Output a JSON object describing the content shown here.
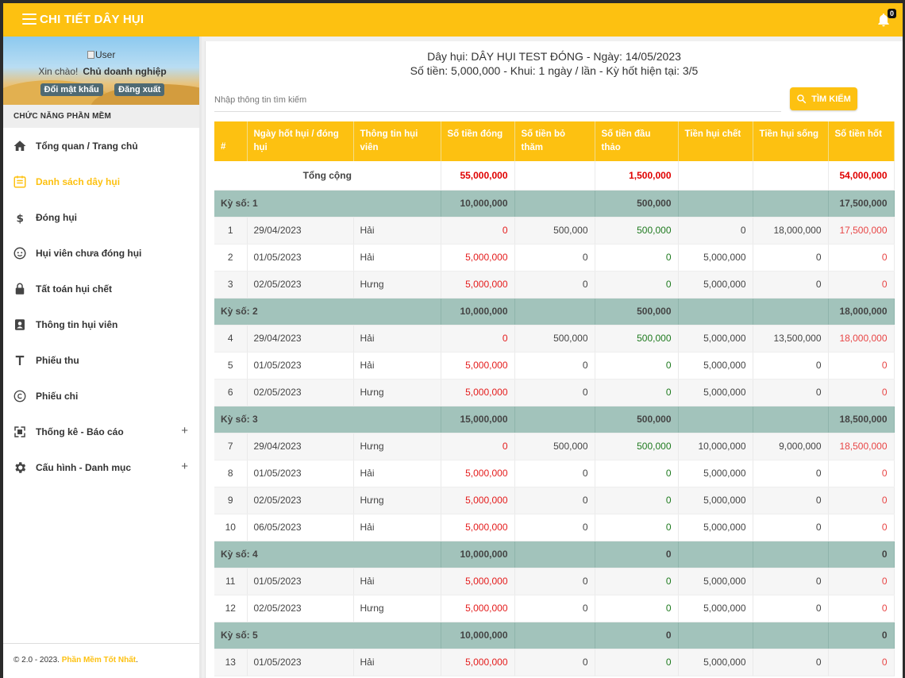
{
  "topbar": {
    "title": "CHI TIẾT DÂY HỤI",
    "badge": "0"
  },
  "sidebar": {
    "user_img_alt": "User",
    "greeting": "Xin chào!",
    "user_name": "Chủ doanh nghiệp",
    "change_password": "Đổi mật khẩu",
    "logout": "Đăng xuất",
    "section": "CHỨC NĂNG PHẦN MỀM",
    "items": [
      {
        "label": "Tổng quan / Trang chủ",
        "icon": "home-icon"
      },
      {
        "label": "Danh sách dây hụi",
        "icon": "list-icon",
        "active": true
      },
      {
        "label": "Đóng hụi",
        "icon": "dollar-icon"
      },
      {
        "label": "Hụi viên chưa đóng hụi",
        "icon": "face-icon"
      },
      {
        "label": "Tất toán hụi chết",
        "icon": "lock-icon"
      },
      {
        "label": "Thông tin hụi viên",
        "icon": "contact-icon"
      },
      {
        "label": "Phiếu thu",
        "icon": "text-icon"
      },
      {
        "label": "Phiếu chi",
        "icon": "copyright-icon"
      },
      {
        "label": "Thống kê - Báo cáo",
        "icon": "stats-icon",
        "expandable": true
      },
      {
        "label": "Cấu hình - Danh mục",
        "icon": "gear-icon",
        "expandable": true
      }
    ],
    "footer_prefix": "© 2.0 - 2023.",
    "footer_link": "Phần Mềm Tốt Nhất",
    "footer_suffix": "."
  },
  "header": {
    "line1": "Dây hụi: DÂY HỤI TEST ĐÓNG - Ngày: 14/05/2023",
    "line2": "Số tiền: 5,000,000 - Khui: 1 ngày / lần - Kỳ hốt hiện tại: 3/5"
  },
  "search": {
    "placeholder": "Nhập thông tin tìm kiếm",
    "value": "",
    "button": "TÌM KIẾM"
  },
  "table": {
    "columns": [
      "#",
      "Ngày hốt hụi / đóng hụi",
      "Thông tin hụi viên",
      "Số tiền đóng",
      "Số tiền bỏ thăm",
      "Số tiền đầu thảo",
      "Tiền hụi chết",
      "Tiền hụi sống",
      "Số tiền hốt"
    ],
    "total": {
      "label": "Tổng cộng",
      "dong": "55,000,000",
      "dau_thao": "1,500,000",
      "hot": "54,000,000"
    },
    "groups": [
      {
        "label": "Kỳ số: 1",
        "dong": "10,000,000",
        "dau_thao": "500,000",
        "hot": "17,500,000",
        "rows": [
          [
            "1",
            "29/04/2023",
            "Hải",
            "0",
            "500,000",
            "500,000",
            "0",
            "18,000,000",
            "17,500,000"
          ],
          [
            "2",
            "01/05/2023",
            "Hải",
            "5,000,000",
            "0",
            "0",
            "5,000,000",
            "0",
            "0"
          ],
          [
            "3",
            "02/05/2023",
            "Hưng",
            "5,000,000",
            "0",
            "0",
            "5,000,000",
            "0",
            "0"
          ]
        ]
      },
      {
        "label": "Kỳ số: 2",
        "dong": "10,000,000",
        "dau_thao": "500,000",
        "hot": "18,000,000",
        "rows": [
          [
            "4",
            "29/04/2023",
            "Hải",
            "0",
            "500,000",
            "500,000",
            "5,000,000",
            "13,500,000",
            "18,000,000"
          ],
          [
            "5",
            "01/05/2023",
            "Hải",
            "5,000,000",
            "0",
            "0",
            "5,000,000",
            "0",
            "0"
          ],
          [
            "6",
            "02/05/2023",
            "Hưng",
            "5,000,000",
            "0",
            "0",
            "5,000,000",
            "0",
            "0"
          ]
        ]
      },
      {
        "label": "Kỳ số: 3",
        "dong": "15,000,000",
        "dau_thao": "500,000",
        "hot": "18,500,000",
        "rows": [
          [
            "7",
            "29/04/2023",
            "Hưng",
            "0",
            "500,000",
            "500,000",
            "10,000,000",
            "9,000,000",
            "18,500,000"
          ],
          [
            "8",
            "01/05/2023",
            "Hải",
            "5,000,000",
            "0",
            "0",
            "5,000,000",
            "0",
            "0"
          ],
          [
            "9",
            "02/05/2023",
            "Hưng",
            "5,000,000",
            "0",
            "0",
            "5,000,000",
            "0",
            "0"
          ],
          [
            "10",
            "06/05/2023",
            "Hải",
            "5,000,000",
            "0",
            "0",
            "5,000,000",
            "0",
            "0"
          ]
        ]
      },
      {
        "label": "Kỳ số: 4",
        "dong": "10,000,000",
        "dau_thao": "0",
        "hot": "0",
        "rows": [
          [
            "11",
            "01/05/2023",
            "Hải",
            "5,000,000",
            "0",
            "0",
            "5,000,000",
            "0",
            "0"
          ],
          [
            "12",
            "02/05/2023",
            "Hưng",
            "5,000,000",
            "0",
            "0",
            "5,000,000",
            "0",
            "0"
          ]
        ]
      },
      {
        "label": "Kỳ số: 5",
        "dong": "10,000,000",
        "dau_thao": "0",
        "hot": "0",
        "rows": [
          [
            "13",
            "01/05/2023",
            "Hải",
            "5,000,000",
            "0",
            "0",
            "5,000,000",
            "0",
            "0"
          ]
        ]
      }
    ]
  },
  "colors": {
    "primary": "#fdc111",
    "group_row": "#a2c3bb",
    "red": "#e41b1b",
    "green": "#1f7a1f"
  }
}
